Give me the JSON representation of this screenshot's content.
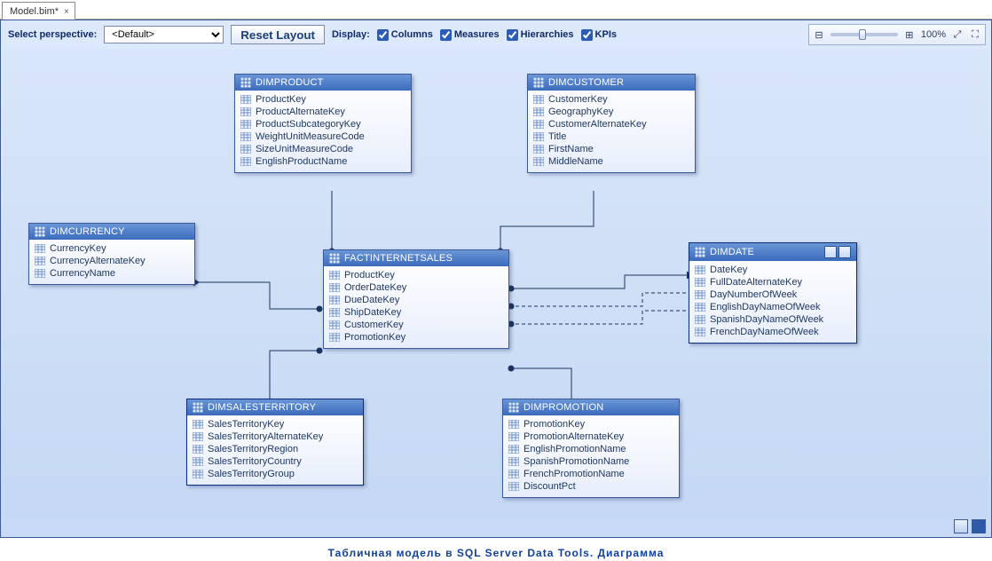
{
  "tab": {
    "label": "Model.bim*",
    "close": "×"
  },
  "toolbar": {
    "perspective_label": "Select perspective:",
    "perspective_value": "<Default>",
    "reset_label": "Reset Layout",
    "display_label": "Display:",
    "columns_label": "Columns",
    "measures_label": "Measures",
    "hierarchies_label": "Hierarchies",
    "kpis_label": "KPIs"
  },
  "zoom": {
    "percent": "100%"
  },
  "entities": {
    "dimproduct": {
      "title": "DimProduct",
      "cols": [
        "ProductKey",
        "ProductAlternateKey",
        "ProductSubcategoryKey",
        "WeightUnitMeasureCode",
        "SizeUnitMeasureCode",
        "EnglishProductName"
      ]
    },
    "dimcustomer": {
      "title": "DimCustomer",
      "cols": [
        "CustomerKey",
        "GeographyKey",
        "CustomerAlternateKey",
        "Title",
        "FirstName",
        "MiddleName"
      ]
    },
    "dimcurrency": {
      "title": "DimCurrency",
      "cols": [
        "CurrencyKey",
        "CurrencyAlternateKey",
        "CurrencyName"
      ]
    },
    "fact": {
      "title": "FactInternetSales",
      "cols": [
        "ProductKey",
        "OrderDateKey",
        "DueDateKey",
        "ShipDateKey",
        "CustomerKey",
        "PromotionKey"
      ]
    },
    "dimdate": {
      "title": "DimDate",
      "cols": [
        "DateKey",
        "FullDateAlternateKey",
        "DayNumberOfWeek",
        "EnglishDayNameOfWeek",
        "SpanishDayNameOfWeek",
        "FrenchDayNameOfWeek"
      ]
    },
    "dimsalesterritory": {
      "title": "DimSalesTerritory",
      "cols": [
        "SalesTerritoryKey",
        "SalesTerritoryAlternateKey",
        "SalesTerritoryRegion",
        "SalesTerritoryCountry",
        "SalesTerritoryGroup"
      ]
    },
    "dimpromotion": {
      "title": "DimPromotion",
      "cols": [
        "PromotionKey",
        "PromotionAlternateKey",
        "EnglishPromotionName",
        "SpanishPromotionName",
        "FrenchPromotionName",
        "DiscountPct"
      ]
    }
  },
  "caption": "Табличная модель в SQL Server Data Tools. Диаграмма"
}
